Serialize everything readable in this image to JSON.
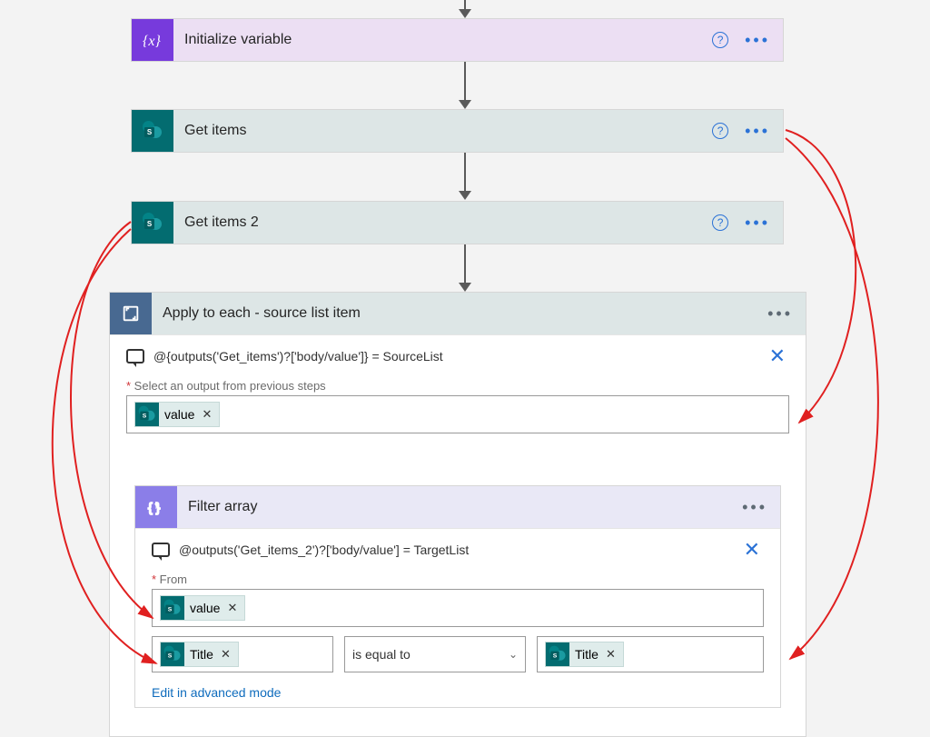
{
  "actions": {
    "init_variable": {
      "title": "Initialize variable"
    },
    "get_items": {
      "title": "Get items"
    },
    "get_items_2": {
      "title": "Get items 2"
    },
    "apply_each": {
      "title": "Apply to each - source list item",
      "comment": "@{outputs('Get_items')?['body/value']} = SourceList",
      "select_label": "Select an output from previous steps",
      "select_token": "value"
    },
    "filter_array": {
      "title": "Filter array",
      "comment": "@outputs('Get_items_2')?['body/value'] = TargetList",
      "from_label": "From",
      "from_token": "value",
      "left_token": "Title",
      "operator": "is equal to",
      "right_token": "Title",
      "advanced_link": "Edit in advanced mode"
    }
  },
  "glyphs": {
    "help": "?",
    "close": "✕",
    "token_remove": "✕"
  }
}
